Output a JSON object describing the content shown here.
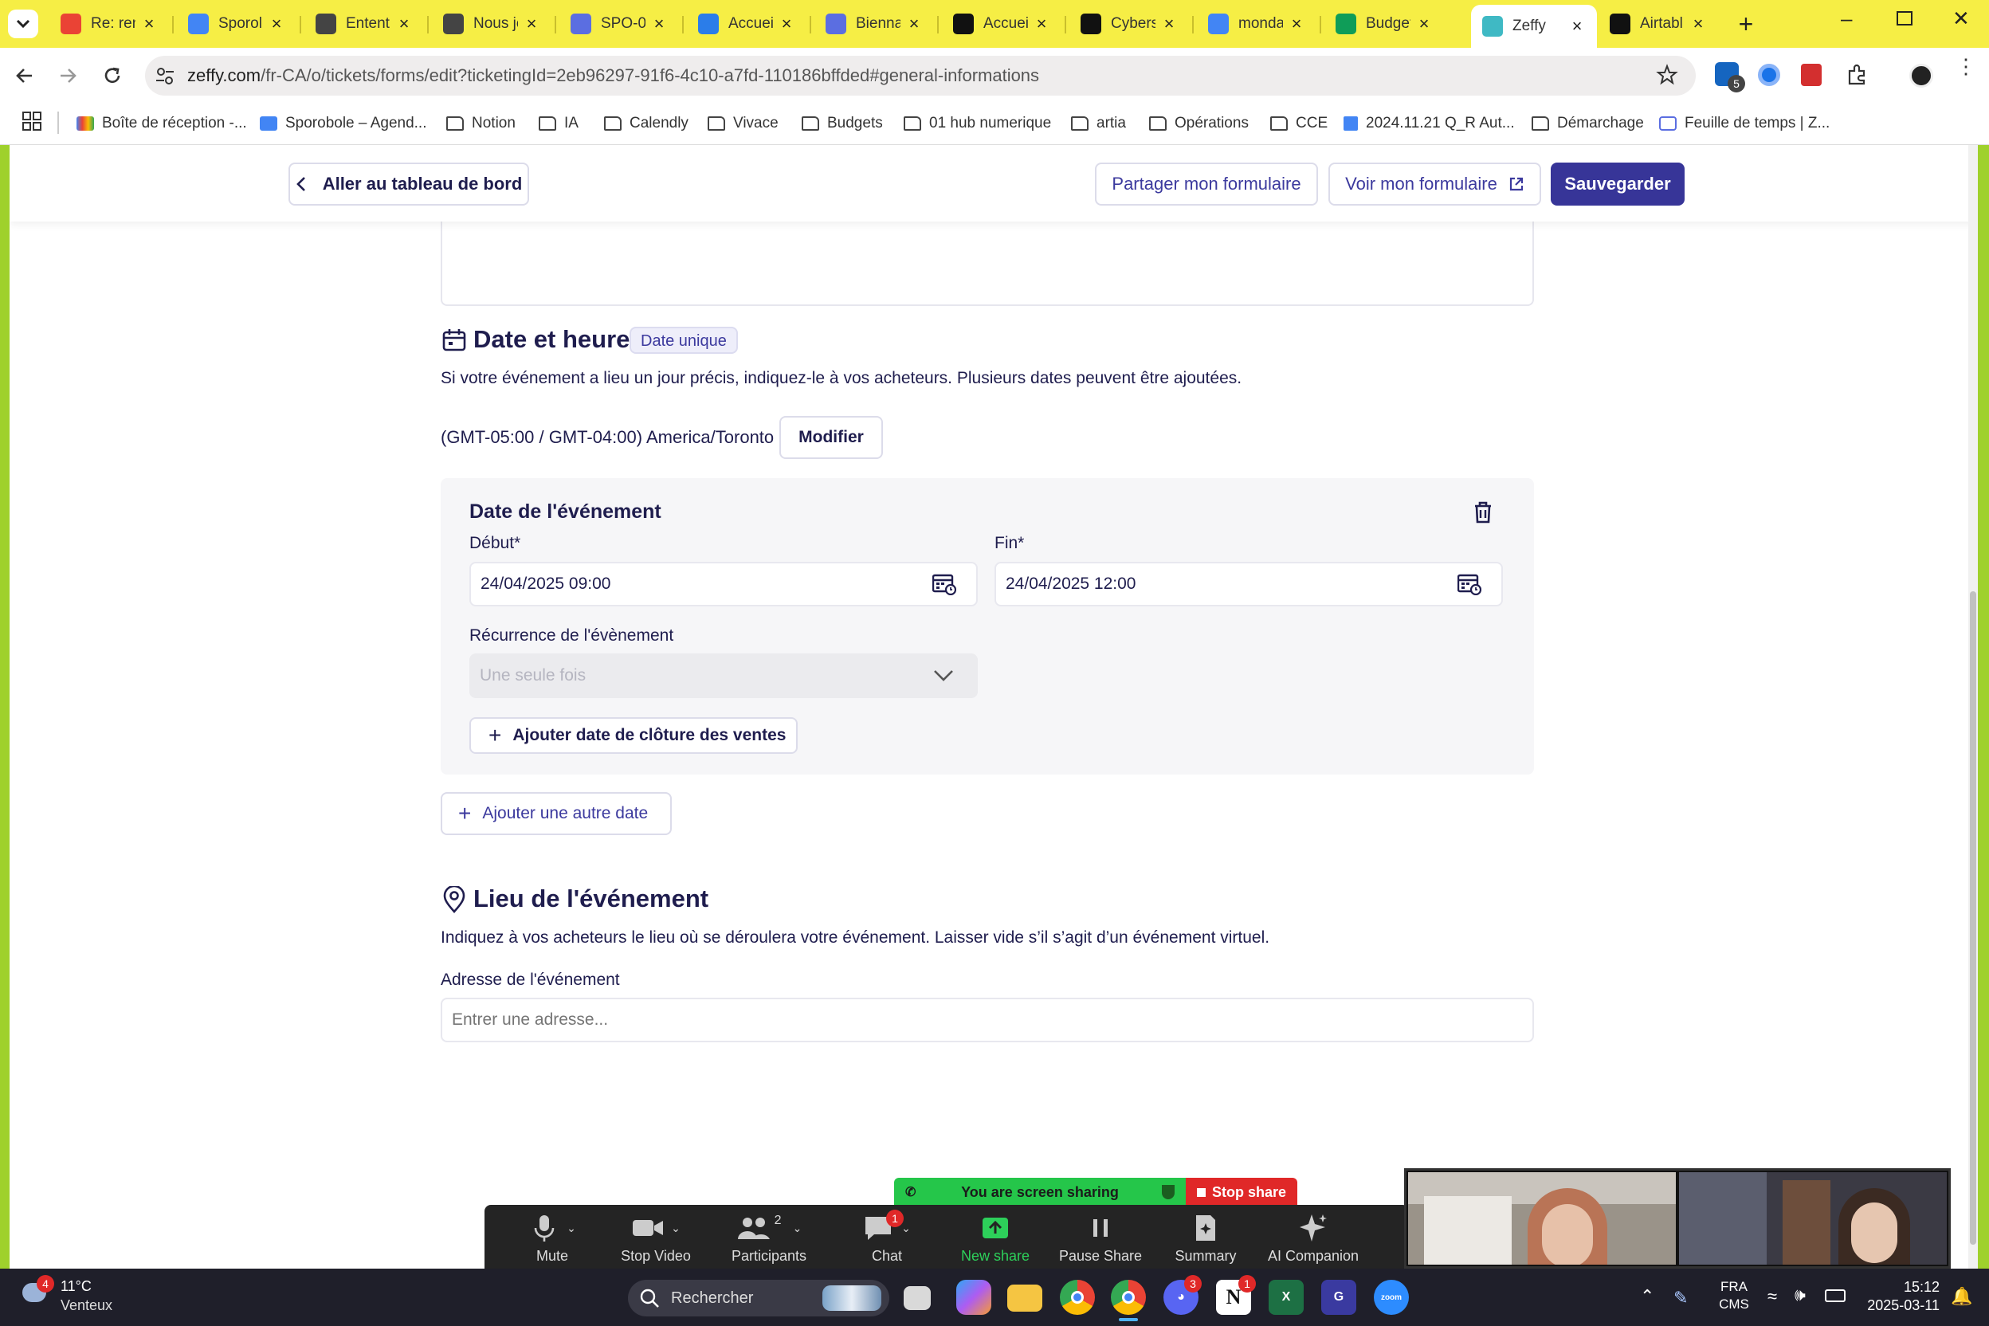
{
  "tabs": [
    {
      "title": "Re: ren",
      "icon": "gmail-icon",
      "color": "#ea4335"
    },
    {
      "title": "Sporol",
      "icon": "calendar-icon",
      "color": "#4285f4"
    },
    {
      "title": "Entent",
      "icon": "film-icon",
      "color": "#444444"
    },
    {
      "title": "Nous je",
      "icon": "film-icon",
      "color": "#444444"
    },
    {
      "title": "SPO-0",
      "icon": "doc-icon",
      "color": "#5b6ee1"
    },
    {
      "title": "Accuei",
      "icon": "canva-icon",
      "color": "#2b7de9"
    },
    {
      "title": "Bienna",
      "icon": "doc-icon",
      "color": "#5b6ee1"
    },
    {
      "title": "Accueil",
      "icon": "o1-icon",
      "color": "#111111"
    },
    {
      "title": "Cybers",
      "icon": "o1-icon",
      "color": "#111111"
    },
    {
      "title": "monda",
      "icon": "google-icon",
      "color": "#4285f4"
    },
    {
      "title": "Budget",
      "icon": "sheets-icon",
      "color": "#0f9d58"
    },
    {
      "title": "Zeffy",
      "icon": "zeffy-icon",
      "color": "#3fb9c4",
      "active": true
    },
    {
      "title": "Airtabl",
      "icon": "o1-icon",
      "color": "#111111"
    }
  ],
  "url": {
    "host": "zeffy.com",
    "path": "/fr-CA/o/tickets/forms/edit?ticketingId=2eb96297-91f6-4c10-a7fd-110186bffded#general-informations"
  },
  "extensions": {
    "badge_count": "5"
  },
  "bookmarks": [
    {
      "label": "Boîte de réception -...",
      "icon": "gmail-icon"
    },
    {
      "label": "Sporobole – Agend...",
      "icon": "calendar-icon"
    },
    {
      "label": "Notion",
      "icon": "folder-icon"
    },
    {
      "label": "IA",
      "icon": "folder-icon"
    },
    {
      "label": "Calendly",
      "icon": "folder-icon"
    },
    {
      "label": "Vivace",
      "icon": "folder-icon"
    },
    {
      "label": "Budgets",
      "icon": "folder-icon"
    },
    {
      "label": "01 hub numerique",
      "icon": "folder-icon"
    },
    {
      "label": "artia",
      "icon": "folder-icon"
    },
    {
      "label": "Opérations",
      "icon": "folder-icon"
    },
    {
      "label": "CCE",
      "icon": "folder-icon"
    },
    {
      "label": "2024.11.21 Q_R Aut...",
      "icon": "doc-icon"
    },
    {
      "label": "Démarchage",
      "icon": "folder-icon"
    },
    {
      "label": "Feuille de temps | Z...",
      "icon": "zeffy-icon"
    }
  ],
  "header": {
    "back_label": "Aller au tableau de bord",
    "share_label": "Partager mon formulaire",
    "view_label": "Voir mon formulaire",
    "save_label": "Sauvegarder"
  },
  "date_section": {
    "title": "Date et heure",
    "badge": "Date unique",
    "description": "Si votre événement a lieu un jour précis, indiquez-le à vos acheteurs. Plusieurs dates peuvent être ajoutées.",
    "timezone": "(GMT-05:00 / GMT-04:00) America/Toronto",
    "modify_label": "Modifier",
    "event_date": {
      "title": "Date de l'événement",
      "start_label": "Début*",
      "start_value": "24/04/2025 09:00",
      "end_label": "Fin*",
      "end_value": "24/04/2025 12:00",
      "recurrence_label": "Récurrence de l'évènement",
      "recurrence_value": "Une seule fois",
      "add_close_label": "Ajouter date de clôture des ventes"
    },
    "add_date_label": "Ajouter une autre date"
  },
  "location_section": {
    "title": "Lieu de l'événement",
    "description": "Indiquez à vos acheteurs le lieu où se déroulera votre événement. Laisser vide s’il s’agit d’un événement virtuel.",
    "address_label": "Adresse de l'événement",
    "address_placeholder": "Entrer une adresse..."
  },
  "zoom": {
    "sharing_text": "You are screen sharing",
    "stop_share": "Stop share",
    "mute": "Mute",
    "stop_video": "Stop Video",
    "participants": "Participants",
    "participants_count": "2",
    "chat": "Chat",
    "chat_badge": "1",
    "new_share": "New share",
    "pause_share": "Pause Share",
    "summary": "Summary",
    "ai_companion": "AI Companion"
  },
  "taskbar": {
    "weather_temp": "11°C",
    "weather_desc": "Venteux",
    "weather_badge": "4",
    "search_placeholder": "Rechercher",
    "discord_badge": "3",
    "notion_badge": "1",
    "lang_top": "FRA",
    "lang_bottom": "CMS",
    "time": "15:12",
    "date": "2025-03-11"
  },
  "colors": {
    "accent": "#373598",
    "text": "#1f1d4e",
    "tabbar": "#f6ee45",
    "frame": "#9fd12c"
  }
}
